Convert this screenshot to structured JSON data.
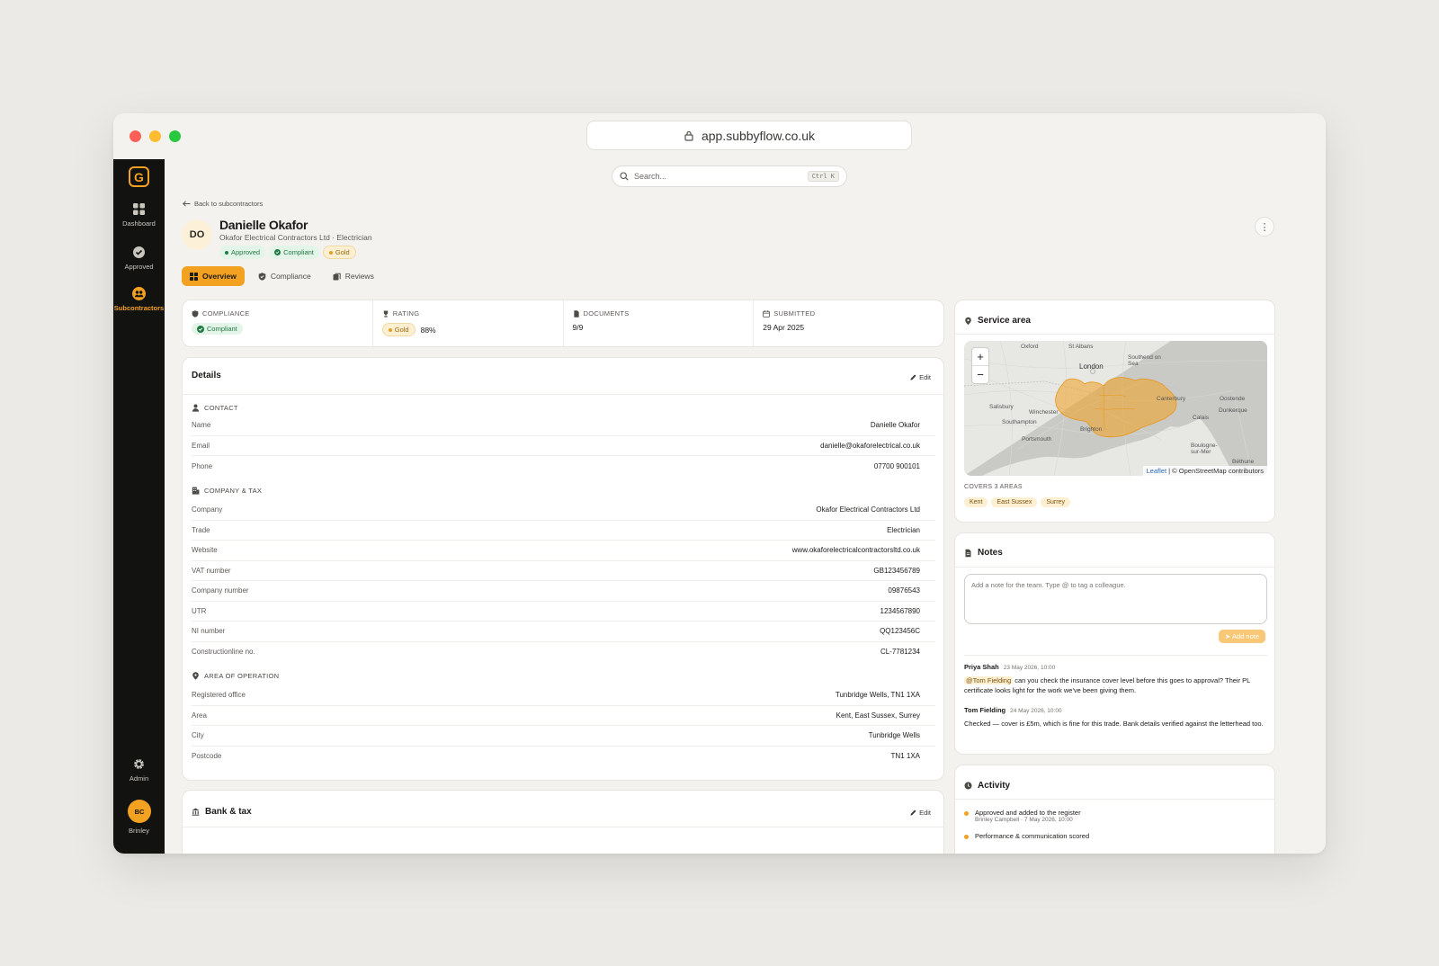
{
  "browser": {
    "url": "app.subbyflow.co.uk"
  },
  "sidebar": {
    "logo": "G",
    "items": [
      {
        "label": "Dashboard",
        "icon": "grid-icon"
      },
      {
        "label": "Approved",
        "icon": "check-circle-icon"
      },
      {
        "label": "Subcontractors",
        "icon": "users-icon"
      },
      {
        "label": "Admin",
        "icon": "gear-icon"
      }
    ],
    "user_initials": "BC",
    "user_name": "Brinley"
  },
  "search": {
    "placeholder": "Search...",
    "shortcut": "Ctrl K"
  },
  "header": {
    "back_label": "Back to subcontractors",
    "initials": "DO",
    "name": "Danielle Okafor",
    "subline": "Okafor Electrical Contractors Ltd · Electrician",
    "badges": {
      "approved": "Approved",
      "compliant": "Compliant",
      "gold": "Gold"
    }
  },
  "tabs": [
    {
      "label": "Overview"
    },
    {
      "label": "Compliance"
    },
    {
      "label": "Reviews"
    }
  ],
  "stats": {
    "compliance": {
      "label": "COMPLIANCE",
      "value": "Compliant"
    },
    "rating": {
      "label": "RATING",
      "tier": "Gold",
      "percent": "88%"
    },
    "documents": {
      "label": "DOCUMENTS",
      "value": "9/9"
    },
    "submitted": {
      "label": "SUBMITTED",
      "value": "29 Apr 2025"
    }
  },
  "details": {
    "title": "Details",
    "edit": "Edit",
    "contact": {
      "label": "CONTACT",
      "rows": [
        {
          "k": "Name",
          "v": "Danielle Okafor"
        },
        {
          "k": "Email",
          "v": "danielle@okaforelectrical.co.uk"
        },
        {
          "k": "Phone",
          "v": "07700 900101"
        }
      ]
    },
    "company": {
      "label": "COMPANY & TAX",
      "rows": [
        {
          "k": "Company",
          "v": "Okafor Electrical Contractors Ltd"
        },
        {
          "k": "Trade",
          "v": "Electrician"
        },
        {
          "k": "Website",
          "v": "www.okaforelectricalcontractorsltd.co.uk"
        },
        {
          "k": "VAT number",
          "v": "GB123456789"
        },
        {
          "k": "Company number",
          "v": "09876543"
        },
        {
          "k": "UTR",
          "v": "1234567890"
        },
        {
          "k": "NI number",
          "v": "QQ123456C"
        },
        {
          "k": "Constructionline no.",
          "v": "CL-7781234"
        }
      ]
    },
    "area": {
      "label": "AREA OF OPERATION",
      "rows": [
        {
          "k": "Registered office",
          "v": "Tunbridge Wells, TN1 1XA"
        },
        {
          "k": "Area",
          "v": "Kent, East Sussex, Surrey"
        },
        {
          "k": "City",
          "v": "Tunbridge Wells"
        },
        {
          "k": "Postcode",
          "v": "TN1 1XA"
        }
      ]
    }
  },
  "bank": {
    "title": "Bank & tax",
    "edit": "Edit"
  },
  "service_area": {
    "title": "Service area",
    "map_labels": {
      "oxford": "Oxford",
      "st_albans": "St Albans",
      "london": "London",
      "southend": "Southend on Sea",
      "canterbury": "Canterbury",
      "oostende": "Oostende",
      "salisbury": "Salisbury",
      "winchester": "Winchester",
      "southampton": "Southampton",
      "calais": "Calais",
      "dunkerque": "Dunkerque",
      "portsmouth": "Portsmouth",
      "brighton": "Brighton",
      "boulogne": "Boulogne-sur-Mer",
      "bethune": "Béthune"
    },
    "zoom_in": "+",
    "zoom_out": "−",
    "attribution_leaflet": "Leaflet",
    "attribution_osm": "| © OpenStreetMap contributors",
    "covers_label": "COVERS 3 AREAS",
    "areas": [
      "Kent",
      "East Sussex",
      "Surrey"
    ],
    "highlight_color": "#f3a120"
  },
  "notes": {
    "title": "Notes",
    "placeholder": "Add a note for the team. Type @ to tag a colleague.",
    "add_label": "Add note",
    "items": [
      {
        "author": "Priya Shah",
        "time": "23 May 2026, 10:00",
        "mention": "@Tom Fielding",
        "text": "can you check the insurance cover level before this goes to approval? Their PL certificate looks light for the work we've been giving them."
      },
      {
        "author": "Tom Fielding",
        "time": "24 May 2026, 10:00",
        "text": "Checked — cover is £5m, which is fine for this trade. Bank details verified against the letterhead too."
      }
    ]
  },
  "activity": {
    "title": "Activity",
    "items": [
      {
        "text": "Approved and added to the register",
        "sub": "Brinley Campbell · 7 May 2026, 10:00"
      },
      {
        "text": "Performance & communication scored",
        "sub": ""
      }
    ]
  },
  "colors": {
    "accent": "#f3a120",
    "sidebar": "#121211",
    "success": "#237a45"
  }
}
